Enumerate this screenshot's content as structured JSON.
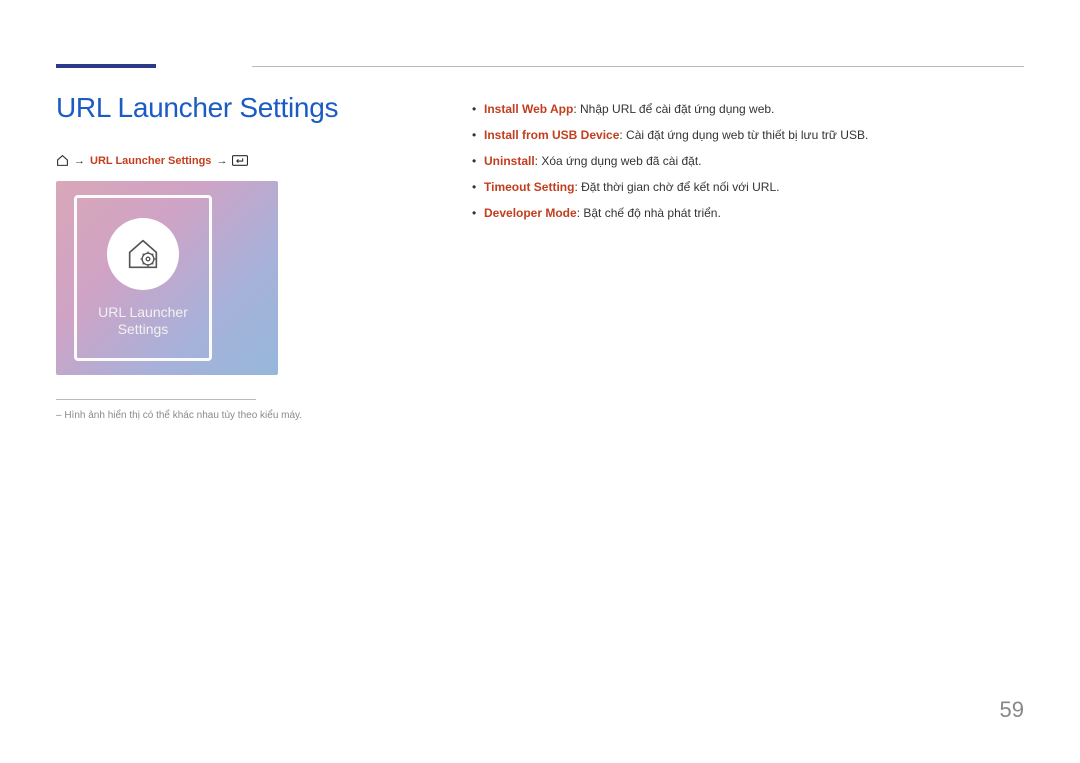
{
  "title": "URL Launcher Settings",
  "breadcrumb_link": "URL Launcher Settings",
  "thumb_caption_line1": "URL Launcher",
  "thumb_caption_line2": "Settings",
  "note_text": "– Hình ảnh hiển thị có thể khác nhau tùy theo kiểu máy.",
  "features": [
    {
      "name": "Install Web App",
      "desc": ": Nhập URL để cài đặt ứng dụng web."
    },
    {
      "name": "Install from USB Device",
      "desc": ": Cài đặt ứng dụng web từ thiết bị lưu trữ USB."
    },
    {
      "name": "Uninstall",
      "desc": ": Xóa ứng dụng web đã cài đặt."
    },
    {
      "name": "Timeout Setting",
      "desc": ": Đặt thời gian chờ để kết nối với URL."
    },
    {
      "name": "Developer Mode",
      "desc": ": Bật chế độ nhà phát triển."
    }
  ],
  "page_number": "59",
  "arrow": "→"
}
